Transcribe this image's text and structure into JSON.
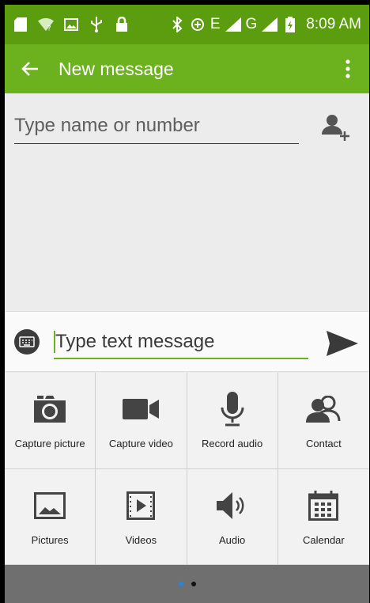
{
  "status_bar": {
    "time": "8:09 AM",
    "network_type": "E",
    "network_type_2": "G",
    "icons": [
      "sd-card-icon",
      "wifi-question-icon",
      "image-icon",
      "usb-icon",
      "lock-icon",
      "bluetooth-icon",
      "data-icon",
      "signal-icon",
      "signal-icon-2",
      "battery-charging-icon"
    ]
  },
  "app_bar": {
    "title": "New message",
    "back_icon": "arrow-back-icon",
    "overflow_icon": "more-vert-icon",
    "color": "#6cb21f"
  },
  "recipient": {
    "placeholder": "Type name or number",
    "value": "",
    "add_contact_icon": "person-add-icon"
  },
  "compose": {
    "placeholder": "Type text message",
    "value": "",
    "keyboard_icon": "keyboard-icon",
    "send_icon": "send-icon"
  },
  "attachments": [
    {
      "label": "Capture picture",
      "icon": "camera-icon"
    },
    {
      "label": "Capture video",
      "icon": "videocam-icon"
    },
    {
      "label": "Record audio",
      "icon": "mic-icon"
    },
    {
      "label": "Contact",
      "icon": "contacts-icon"
    },
    {
      "label": "Pictures",
      "icon": "image-icon"
    },
    {
      "label": "Videos",
      "icon": "video-file-icon"
    },
    {
      "label": "Audio",
      "icon": "speaker-icon"
    },
    {
      "label": "Calendar",
      "icon": "calendar-icon"
    }
  ],
  "pager": {
    "pages": 2,
    "active": 1,
    "active_color": "#1e88e5"
  }
}
